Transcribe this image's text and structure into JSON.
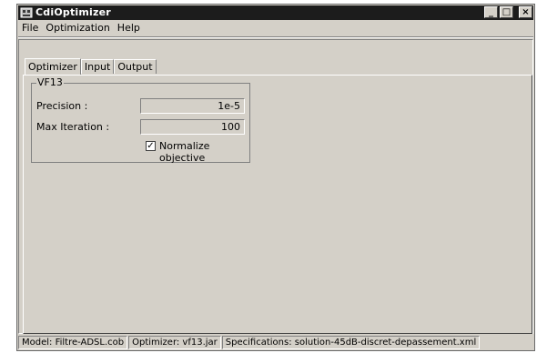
{
  "window": {
    "title": "CdiOptimizer",
    "minimize": "_",
    "maximize": "□",
    "close": "×"
  },
  "menu": [
    "File",
    "Optimization",
    "Help"
  ],
  "tabs": [
    "Optimizer",
    "Input",
    "Output"
  ],
  "groupbox": {
    "title": "VF13",
    "precision_label": "Precision :",
    "precision_value": "1e-5",
    "max_iter_label": "Max Iteration :",
    "max_iter_value": "100",
    "normalize_label": "Normalize objective",
    "normalize_checked": "✓"
  },
  "status": {
    "model": "Model: Filtre-ADSL.cob",
    "optimizer": "Optimizer: vf13.jar",
    "specs": "Specifications: solution-45dB-discret-depassement.xml"
  }
}
